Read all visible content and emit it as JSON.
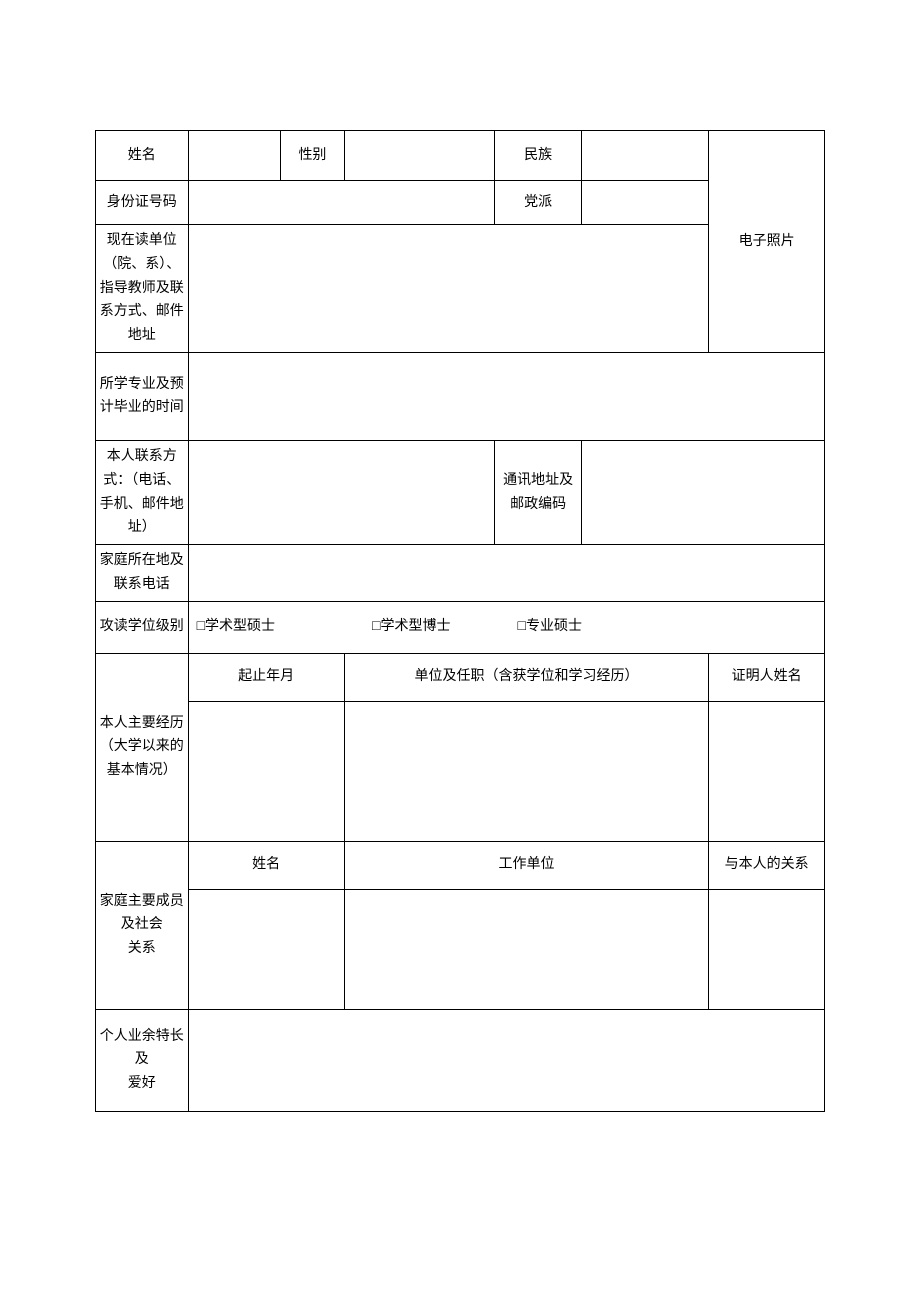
{
  "labels": {
    "name": "姓名",
    "gender": "性别",
    "ethnicity": "民族",
    "id_number": "身份证号码",
    "party": "党派",
    "photo": "电子照片",
    "current_unit": "现在读单位（院、系）、指导教师及联系方式、邮件地址",
    "major_grad": "所学专业及预计毕业的时间",
    "contact": "本人联系方式：（电话、手机、邮件地址）",
    "address": "通讯地址及邮政编码",
    "home": "家庭所在地及联系电话",
    "degree_type": "攻读学位级别",
    "degree_opt1": "□学术型硕士",
    "degree_opt2": "□学术型博士",
    "degree_opt3": "□专业硕士",
    "experience": "本人主要经历（大学以来的基本情况）",
    "exp_dates": "起止年月",
    "exp_unit": "单位及任职（含获学位和学习经历）",
    "exp_witness": "证明人姓名",
    "family": "家庭主要成员及社会",
    "family_relation_line": "关系",
    "family_name": "姓名",
    "family_unit": "工作单位",
    "family_relation": "与本人的关系",
    "hobby": "个人业余特长及",
    "hobby_line2": "爱好"
  }
}
